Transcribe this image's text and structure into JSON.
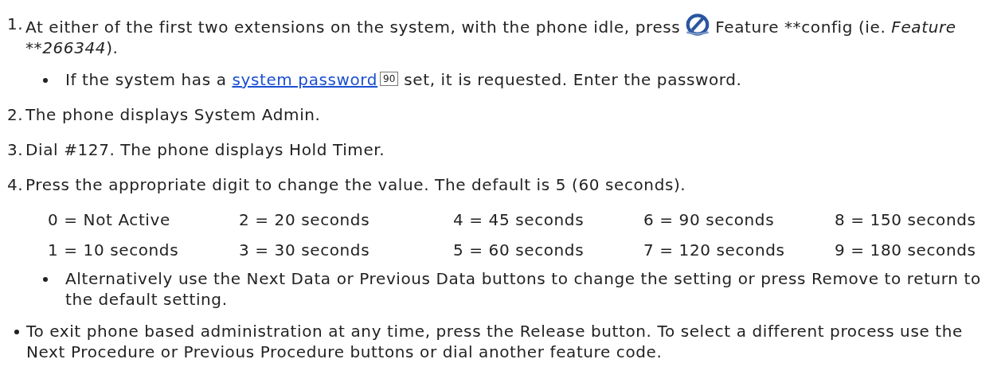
{
  "steps": [
    {
      "number": "1.",
      "segments": [
        {
          "kind": "text",
          "text": "At either of the first two extensions on the system, with the phone idle, press "
        },
        {
          "kind": "feature-icon"
        },
        {
          "kind": "text",
          "text": " Feature **config (ie. "
        },
        {
          "kind": "italic",
          "text": "Feature **266344"
        },
        {
          "kind": "text",
          "text": ")."
        }
      ],
      "bullets": [
        {
          "segments": [
            {
              "kind": "text",
              "text": "If the system has a "
            },
            {
              "kind": "link",
              "text": "system password"
            },
            {
              "kind": "page-ref",
              "text": "90"
            },
            {
              "kind": "text",
              "text": " set, it is requested. Enter the password."
            }
          ]
        }
      ]
    },
    {
      "number": "2.",
      "segments": [
        {
          "kind": "text",
          "text": "The phone displays System Admin."
        }
      ]
    },
    {
      "number": "3.",
      "segments": [
        {
          "kind": "text",
          "text": "Dial #127. The phone displays Hold Timer."
        }
      ]
    },
    {
      "number": "4.",
      "segments": [
        {
          "kind": "text",
          "text": "Press the appropriate digit to change the value. The default is 5 (60 seconds)."
        }
      ],
      "table": [
        [
          "0 = Not Active",
          "2 = 20 seconds",
          "4 = 45 seconds",
          "6 = 90 seconds",
          "8 = 150 seconds"
        ],
        [
          "1 = 10 seconds",
          "3 = 30 seconds",
          "5 = 60 seconds",
          "7 = 120 seconds",
          "9 = 180 seconds"
        ]
      ],
      "bullets": [
        {
          "segments": [
            {
              "kind": "text",
              "text": "Alternatively use the Next Data or Previous Data buttons to change the setting or press Remove to return to the default setting."
            }
          ]
        }
      ]
    }
  ],
  "notes": [
    {
      "segments": [
        {
          "kind": "text",
          "text": "To exit phone based administration at any time, press the Release button. To select a different process use the Next Procedure or Previous Procedure buttons or dial another feature code."
        }
      ]
    }
  ]
}
